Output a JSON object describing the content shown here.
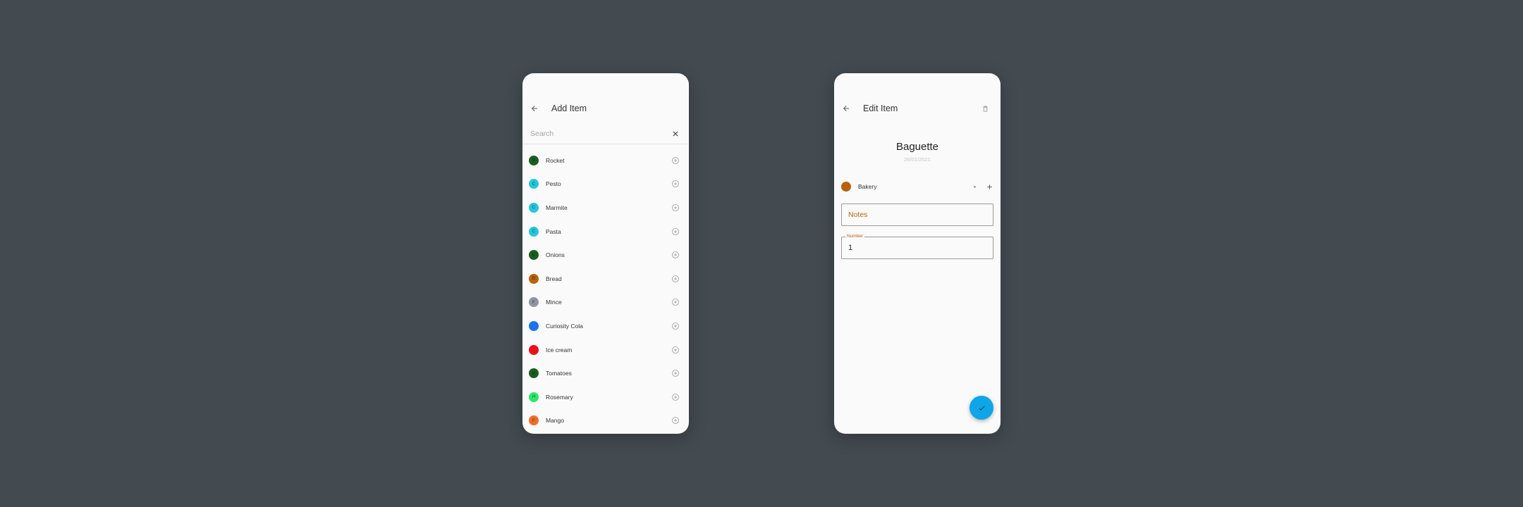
{
  "colors": {
    "background": "#434a50",
    "surface": "#fafafa",
    "accent": "#b8620c",
    "fab": "#0ea5e9"
  },
  "add_screen": {
    "title": "Add Item",
    "back_icon": "arrow-left-icon",
    "search": {
      "placeholder": "Search",
      "value": "",
      "clear_icon": "close-icon"
    },
    "add_icon": "add-circle-outline-icon",
    "items": [
      {
        "label": "Rocket",
        "initial": "V",
        "color": "#1b5e20"
      },
      {
        "label": "Pesto",
        "initial": "C",
        "color": "#26c6da"
      },
      {
        "label": "Marmite",
        "initial": "C",
        "color": "#26c6da"
      },
      {
        "label": "Pasta",
        "initial": "C",
        "color": "#26c6da"
      },
      {
        "label": "Onions",
        "initial": "V",
        "color": "#1b5e20"
      },
      {
        "label": "Bread",
        "initial": "B",
        "color": "#b8620c"
      },
      {
        "label": "Mince",
        "initial": "F",
        "color": "#8f96a0"
      },
      {
        "label": "Curiosity Cola",
        "initial": "",
        "color": "#1a73e8"
      },
      {
        "label": "Ice cream",
        "initial": "",
        "color": "#e8101a"
      },
      {
        "label": "Tomatoes",
        "initial": "V",
        "color": "#1b5e20"
      },
      {
        "label": "Rosemary",
        "initial": "H",
        "color": "#2ee66a"
      },
      {
        "label": "Mango",
        "initial": "F",
        "color": "#ef6c2a"
      }
    ]
  },
  "edit_screen": {
    "title": "Edit Item",
    "back_icon": "arrow-left-icon",
    "delete_icon": "trash-icon",
    "item_name": "Baguette",
    "date": "26/01/2021",
    "category": {
      "label": "Bakery",
      "color": "#b8620c",
      "dropdown_icon": "caret-down-icon",
      "add_icon": "plus-icon"
    },
    "notes": {
      "placeholder": "Notes",
      "value": ""
    },
    "number": {
      "label": "Number",
      "value": "1"
    },
    "fab_icon": "check-icon"
  }
}
